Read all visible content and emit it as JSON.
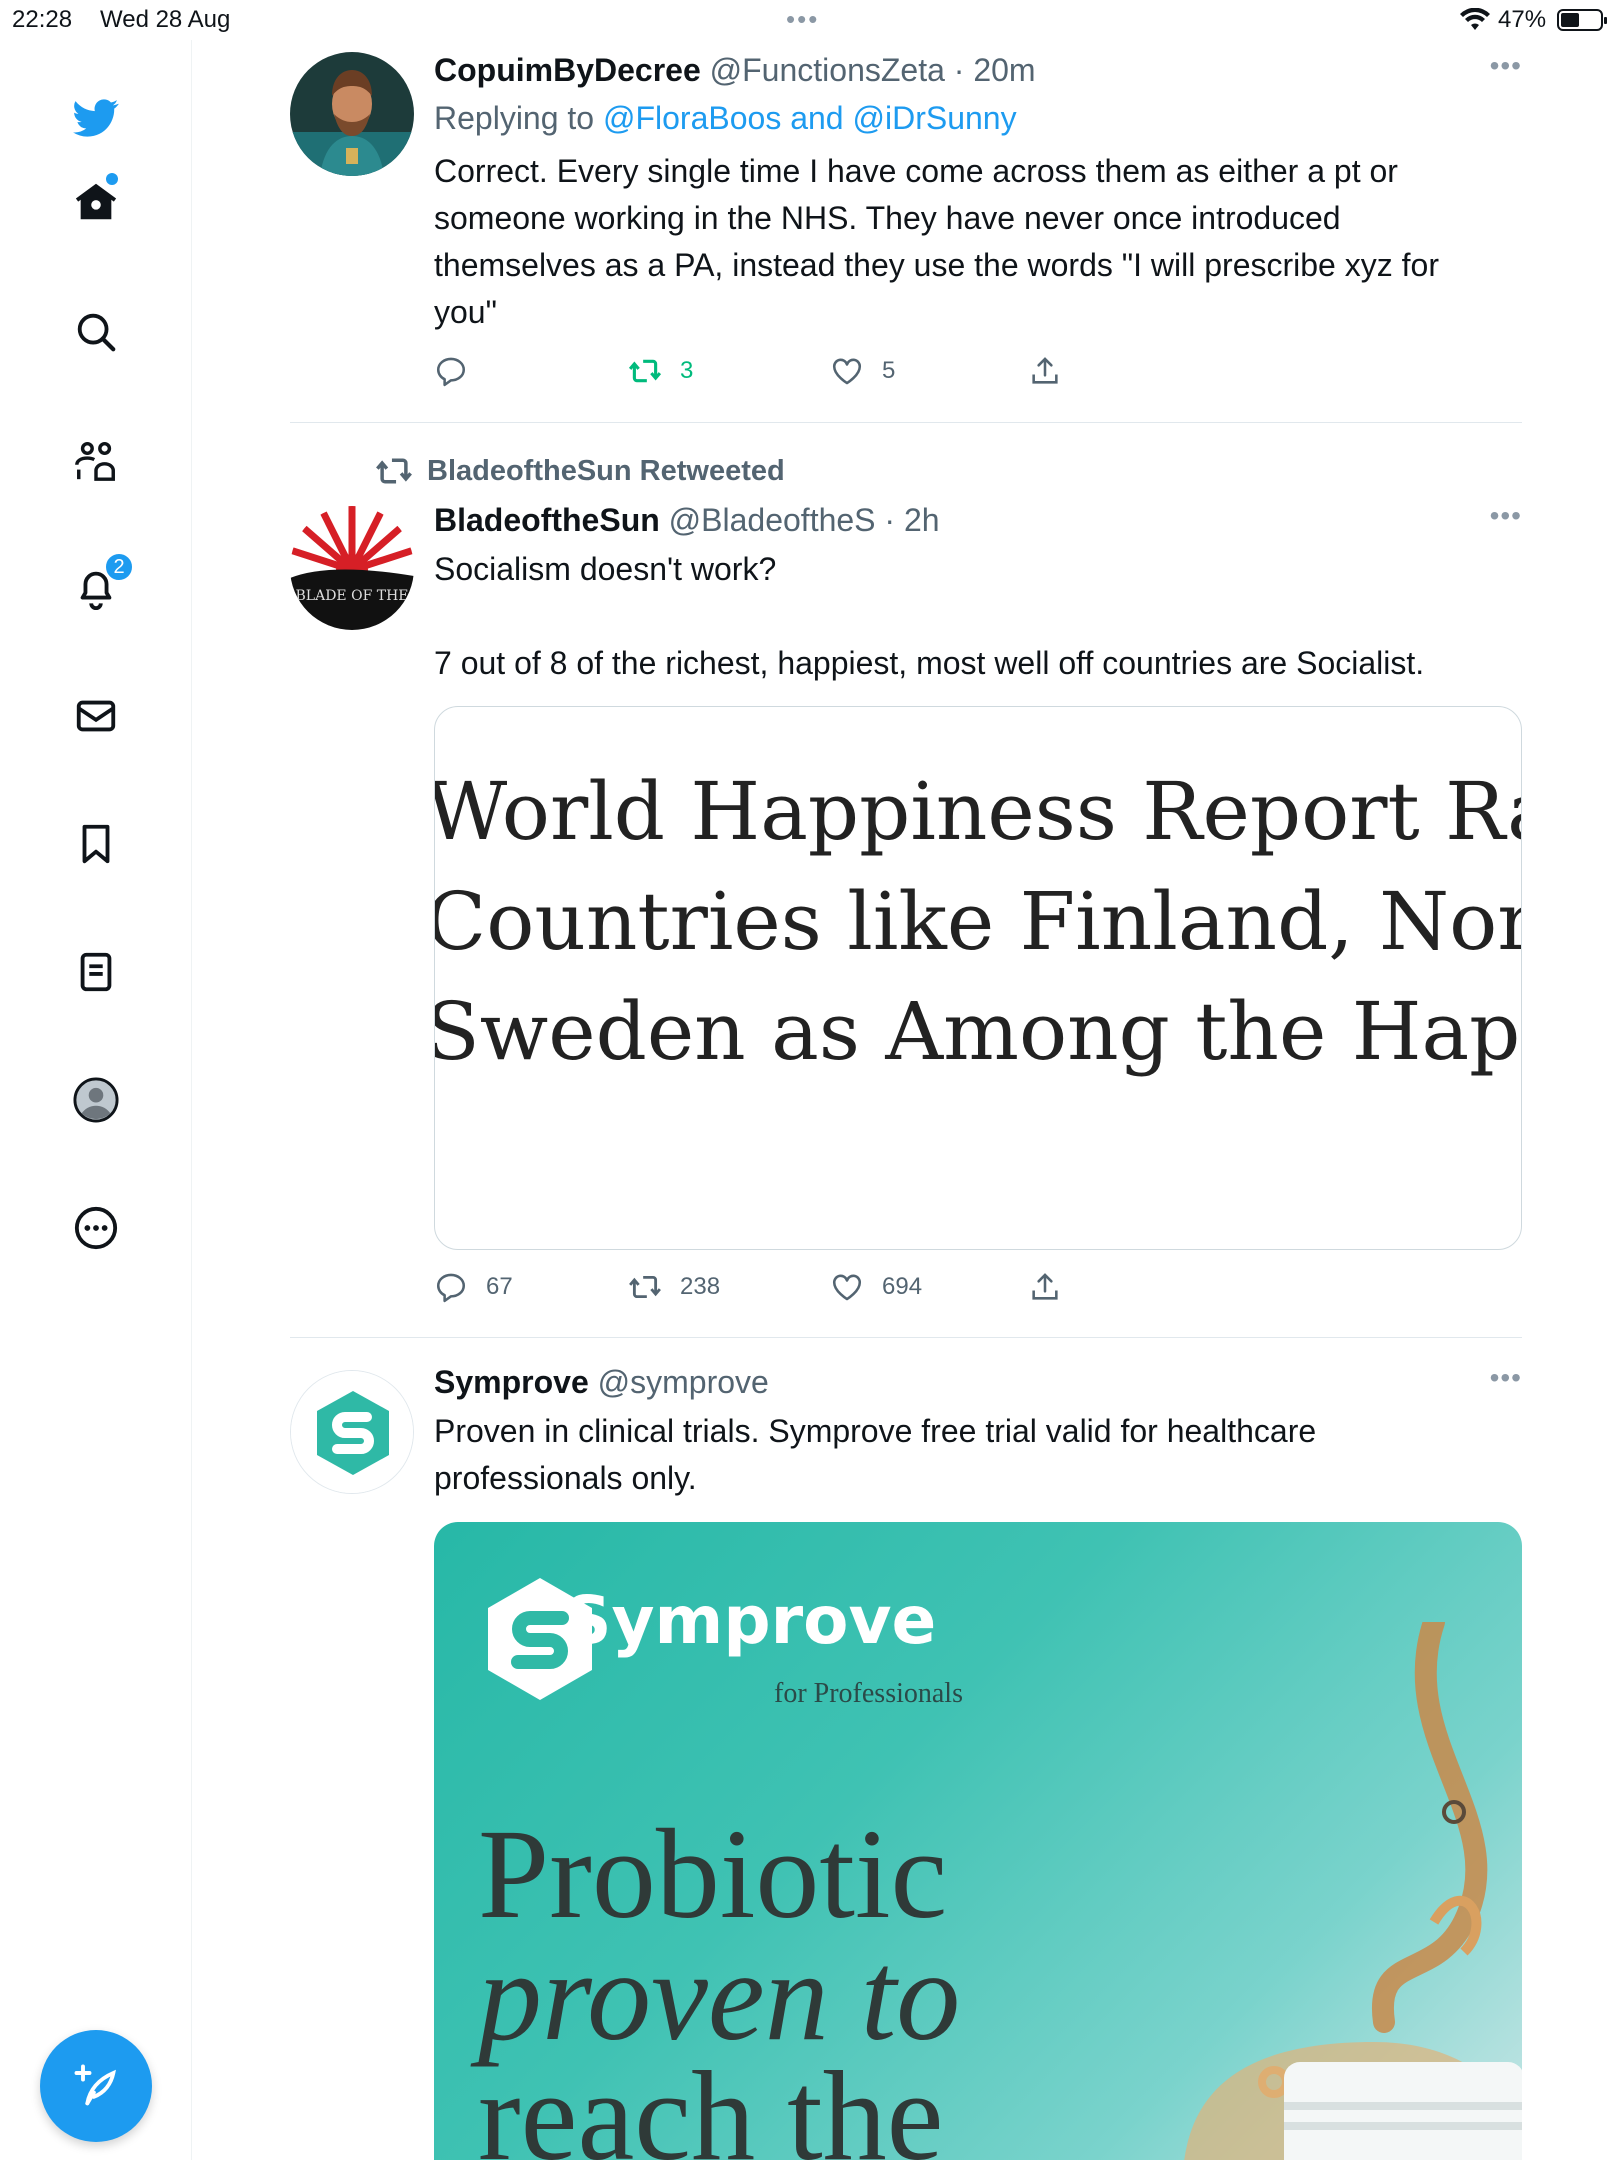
{
  "status_bar": {
    "time": "22:28",
    "date": "Wed 28 Aug",
    "center_indicator": "•••",
    "battery_pct": "47%",
    "battery_level": 0.47
  },
  "sidebar": {
    "items": [
      {
        "name": "twitter-logo-icon"
      },
      {
        "name": "home-icon",
        "has_dot": true
      },
      {
        "name": "search-icon"
      },
      {
        "name": "communities-icon"
      },
      {
        "name": "notifications-icon",
        "badge": "2"
      },
      {
        "name": "messages-icon"
      },
      {
        "name": "bookmarks-icon"
      },
      {
        "name": "lists-icon"
      },
      {
        "name": "profile-icon"
      },
      {
        "name": "more-icon"
      }
    ],
    "compose_icon": "compose-feather-icon",
    "accent_color": "#1d9bf0"
  },
  "tweets": [
    {
      "name": "CopuimByDecree",
      "handle_time": "@FunctionsZeta · 20m",
      "reply_prefix": "Replying to",
      "reply_handles": "@FloraBoos and @iDrSunny",
      "text_lines": [
        "Correct. Every single time I have come across them as either a pt or",
        "someone working in the NHS. They have never once introduced",
        "themselves as a PA, instead they use the words \"I will prescribe xyz for",
        "you\""
      ],
      "actions": {
        "reply": "",
        "retweet": "3",
        "like": "5",
        "share": ""
      },
      "retweet_color": "#00ba7c"
    },
    {
      "retweeted_by": "BladeoftheSun Retweeted",
      "name": "BladeoftheSun",
      "handle_time": "@BladeoftheS · 2h",
      "text_line1": "Socialism doesn't work?",
      "text_line2": "7 out of 8 of the richest, happiest, most well off countries are Socialist.",
      "article_lines": [
        "World Happiness Report Ranks",
        "Countries like Finland, Norway,",
        "Sweden as Among the Happiest"
      ],
      "avatar_text": "BLADE OF THE",
      "actions": {
        "reply": "67",
        "retweet": "238",
        "like": "694",
        "share": ""
      }
    },
    {
      "name": "Symprove",
      "handle_time": "@symprove",
      "text_lines": [
        "Proven in clinical trials. Symprove free trial valid for healthcare",
        "professionals only."
      ],
      "ad": {
        "brand": "Symprove",
        "sub": "for Professionals",
        "headline1": "Probiotic",
        "headline2": "proven to",
        "headline3": "reach the"
      }
    }
  ]
}
